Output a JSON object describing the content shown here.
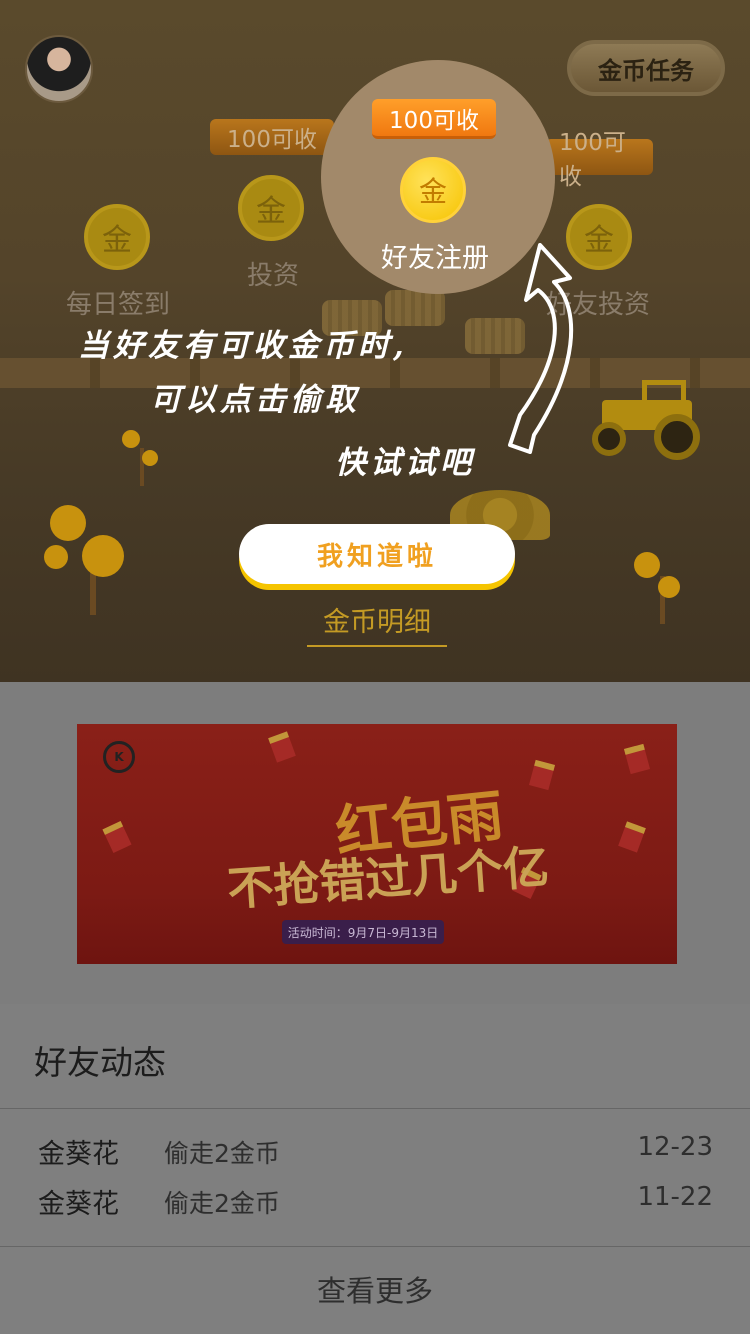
{
  "header": {
    "task_button": "金币任务"
  },
  "farm": {
    "stations": [
      {
        "label": "每日签到",
        "coin": "金"
      },
      {
        "label": "投资",
        "coin": "金",
        "badge": "100可收"
      },
      {
        "label": "好友注册",
        "coin": "金",
        "badge": "100可收"
      },
      {
        "label": "好友投资",
        "coin": "金",
        "badge": "100可收"
      }
    ]
  },
  "guide": {
    "line1": "当好友有可收金币时,",
    "line2": "可以点击偷取",
    "line3": "快试试吧",
    "confirm_button": "我知道啦",
    "detail_link": "金币明细"
  },
  "banner": {
    "title_main": "红包雨",
    "title_sub": "不抢错过几个亿",
    "period": "活动时间：9月7日-9月13日",
    "logo": "K"
  },
  "friends": {
    "title": "好友动态",
    "items": [
      {
        "name": "金葵花",
        "action": "偷走2金币",
        "date": "12-23"
      },
      {
        "name": "金葵花",
        "action": "偷走2金币",
        "date": "11-22"
      }
    ],
    "more": "查看更多"
  },
  "colors": {
    "accent_orange": "#f07810",
    "button_text": "#f0a020",
    "link_gold": "#c49a24",
    "coin_yellow": "#f6c300"
  }
}
